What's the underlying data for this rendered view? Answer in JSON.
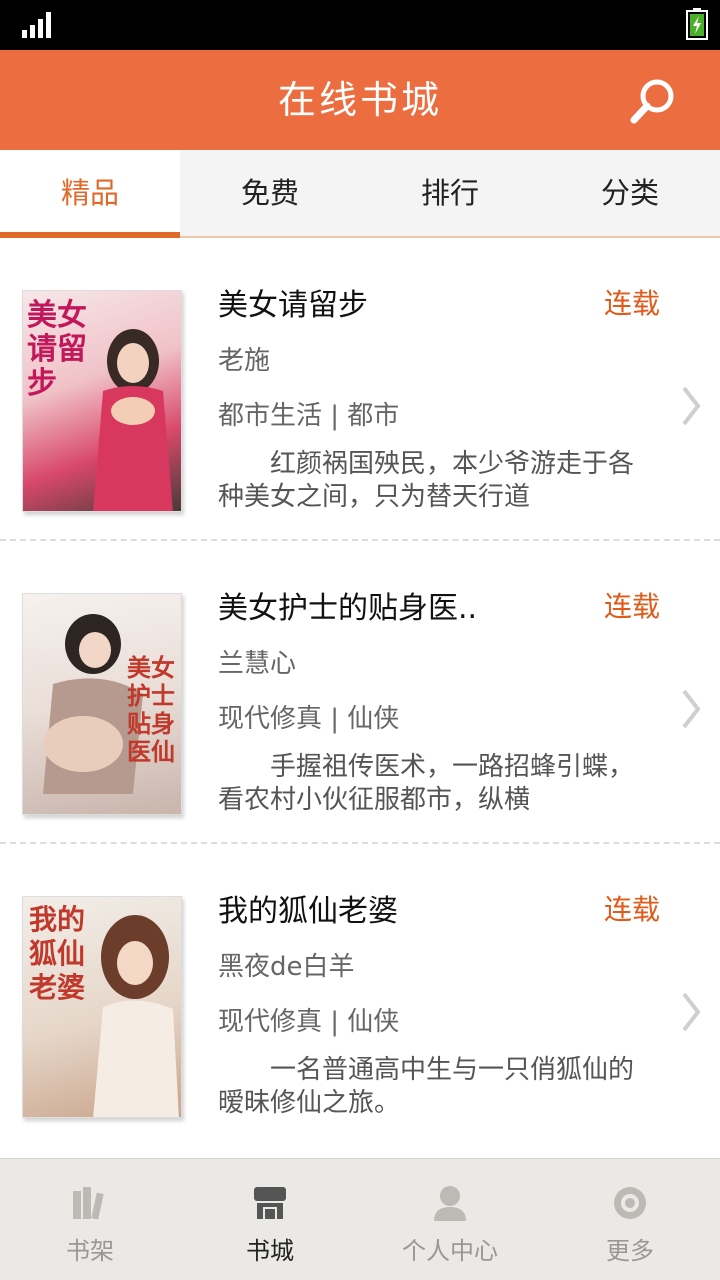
{
  "header": {
    "title": "在线书城",
    "search_icon": "search-icon"
  },
  "tabs": [
    {
      "label": "精品",
      "active": true
    },
    {
      "label": "免费",
      "active": false
    },
    {
      "label": "排行",
      "active": false
    },
    {
      "label": "分类",
      "active": false
    }
  ],
  "books": [
    {
      "title": "美女请留步",
      "status": "连载",
      "author": "老施",
      "genre": "都市生活 | 都市",
      "desc": "红颜祸国殃民，本少爷游走于各种美女之间，只为替天行道",
      "cover_text": "美女请留步"
    },
    {
      "title": "美女护士的贴身医..",
      "status": "连载",
      "author": "兰慧心",
      "genre": "现代修真 | 仙侠",
      "desc": "手握祖传医术，一路招蜂引蝶，看农村小伙征服都市，纵横",
      "cover_text": "美女护士贴身医仙"
    },
    {
      "title": "我的狐仙老婆",
      "status": "连载",
      "author": "黑夜de白羊",
      "genre": "现代修真 | 仙侠",
      "desc": "一名普通高中生与一只俏狐仙的暧昧修仙之旅。",
      "cover_text": "我的狐仙老婆"
    }
  ],
  "bottom_nav": [
    {
      "label": "书架",
      "icon": "bookshelf-icon",
      "active": false
    },
    {
      "label": "书城",
      "icon": "bookstore-icon",
      "active": true
    },
    {
      "label": "个人中心",
      "icon": "user-icon",
      "active": false
    },
    {
      "label": "更多",
      "icon": "more-icon",
      "active": false
    }
  ],
  "colors": {
    "accent": "#ec6d3f",
    "tab_active": "#e06a2a",
    "status": "#e05a1a"
  }
}
